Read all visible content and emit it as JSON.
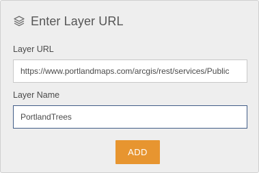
{
  "header": {
    "icon": "layers-icon",
    "title": "Enter Layer URL"
  },
  "form": {
    "url_label": "Layer URL",
    "url_value": "https://www.portlandmaps.com/arcgis/rest/services/Public",
    "name_label": "Layer Name",
    "name_value": "PortlandTrees",
    "add_label": "ADD"
  },
  "colors": {
    "panel_background": "#eeeeee",
    "accent_button": "#e79530",
    "focused_border": "#3f5b86"
  }
}
